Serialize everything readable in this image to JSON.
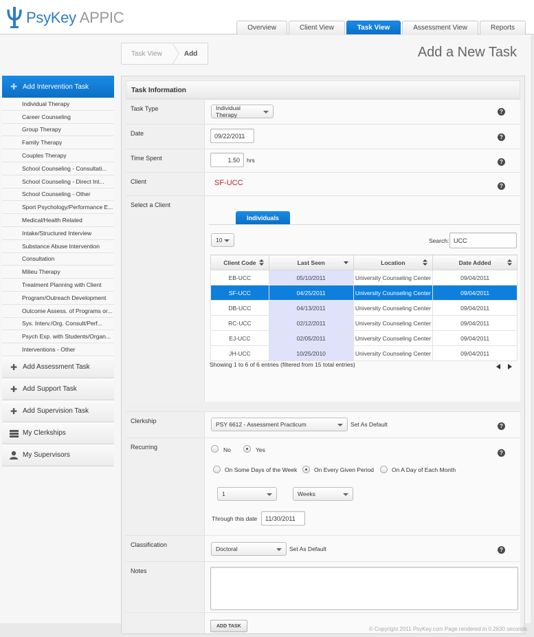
{
  "header": {
    "brand": "PsyKey",
    "brand_suffix": "APPIC",
    "tabs": [
      {
        "label": "Overview",
        "active": false
      },
      {
        "label": "Client View",
        "active": false
      },
      {
        "label": "Task View",
        "active": true
      },
      {
        "label": "Assessment View",
        "active": false
      },
      {
        "label": "Reports",
        "active": false
      }
    ]
  },
  "breadcrumb": {
    "parent": "Task View",
    "current": "Add"
  },
  "page_title": "Add a New Task",
  "sidebar": {
    "head": "Add Intervention Task",
    "subitems": [
      "Individual Therapy",
      "Career Counseling",
      "Group Therapy",
      "Family Therapy",
      "Couples Therapy",
      "School Counseling - Consultati...",
      "School Counseling - Direct Int...",
      "School Counseling - Other",
      "Sport Psychology/Performance E...",
      "Medical/Health Related",
      "Intake/Structured Interview",
      "Substance Abuse Intervention",
      "Consultation",
      "Milieu Therapy",
      "Treatment Planning with Client",
      "Program/Outreach Development",
      "Outcome Assess. of Programs or...",
      "Sys. Interv./Org. Consult/Perf...",
      "Psych Exp. with Students/Organ...",
      "Interventions - Other"
    ],
    "main_items": [
      {
        "label": "Add Assessment Task",
        "icon": "plus-icon"
      },
      {
        "label": "Add Support Task",
        "icon": "plus-icon"
      },
      {
        "label": "Add Supervision Task",
        "icon": "plus-icon"
      },
      {
        "label": "My Clerkships",
        "icon": "stack-icon"
      },
      {
        "label": "My Supervisors",
        "icon": "person-icon"
      }
    ]
  },
  "form": {
    "title": "Task Information",
    "help_glyph": "?",
    "task_type": {
      "label": "Task Type",
      "value": "Individual Therapy"
    },
    "date": {
      "label": "Date",
      "value": "09/22/2011"
    },
    "time_spent": {
      "label": "Time Spent",
      "value": "1.50",
      "unit": "hrs"
    },
    "client": {
      "label": "Client",
      "value": "SF-UCC"
    },
    "select_client": {
      "label": "Select a Client",
      "tab": "Individuals",
      "page_size": "10",
      "search_label": "Search:",
      "search_value": "UCC",
      "columns": [
        "Client Code",
        "Last Seen",
        "Location",
        "Date Added"
      ],
      "rows": [
        [
          "EB-UCC",
          "05/10/2011",
          "University Counseling Center",
          "09/04/2011"
        ],
        [
          "SF-UCC",
          "04/25/2011",
          "University Counseling Center",
          "09/04/2011"
        ],
        [
          "DB-UCC",
          "04/13/2011",
          "University Counseling Center",
          "09/04/2011"
        ],
        [
          "RC-UCC",
          "02/12/2011",
          "University Counseling Center",
          "09/04/2011"
        ],
        [
          "EJ-UCC",
          "02/05/2011",
          "University Counseling Center",
          "09/04/2011"
        ],
        [
          "JH-UCC",
          "10/25/2010",
          "University Counseling Center",
          "09/04/2011"
        ]
      ],
      "selected_row": 1,
      "info": "Showing 1 to 6 of 6 entries (filtered from 15 total entries)"
    },
    "clerkship": {
      "label": "Clerkship",
      "value": "PSY 6612 - Assessment Practicum",
      "default_label": "Set As Default"
    },
    "recurring": {
      "label": "Recurring",
      "no": "No",
      "yes": "Yes",
      "opt1": "On Some Days of the Week",
      "opt2": "On Every Given Period",
      "opt3": "On A Day of Each Month",
      "count": "1",
      "period": "Weeks",
      "through_label": "Through this date",
      "through_value": "11/30/2011"
    },
    "classification": {
      "label": "Classification",
      "value": "Doctoral",
      "default_label": "Set As Default"
    },
    "notes": {
      "label": "Notes",
      "value": ""
    },
    "submit": "ADD TASK"
  },
  "footer": "© Copyright 2011 PsyKey.com Page rendered in 0.2830 seconds"
}
